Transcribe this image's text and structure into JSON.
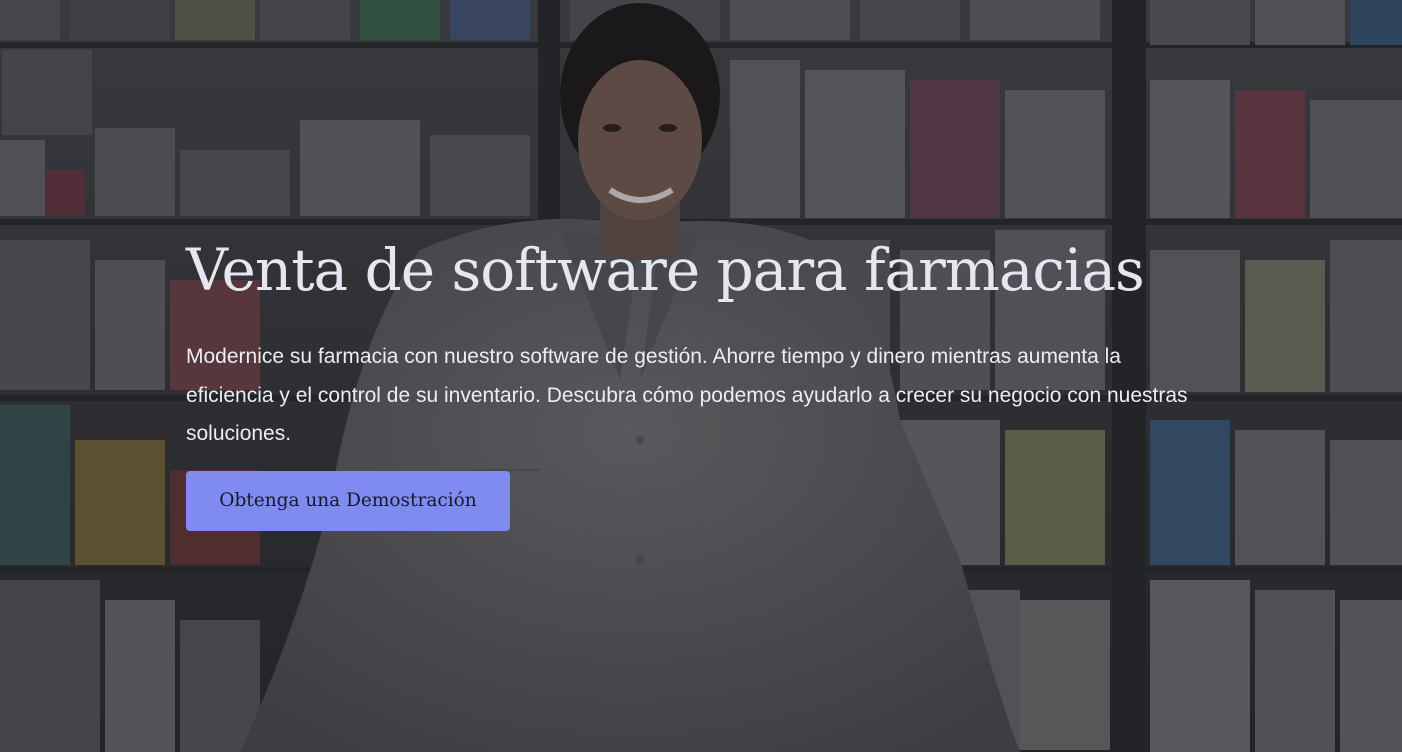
{
  "hero": {
    "title": "Venta de software para farmacias",
    "subtitle": "Modernice su farmacia con nuestro software de gestión. Ahorre tiempo y dinero mientras aumenta la eficiencia y el control de su inventario. Descubra cómo podemos ayudarlo a crecer su negocio con nuestras soluciones.",
    "cta_label": "Obtenga una Demostración",
    "background_image": "pharmacist-in-pharmacy-photo"
  },
  "colors": {
    "cta_background": "#7f8bf0",
    "cta_text": "#171a2e",
    "title_text": "#e6e6f0",
    "body_text": "#ececf2"
  }
}
